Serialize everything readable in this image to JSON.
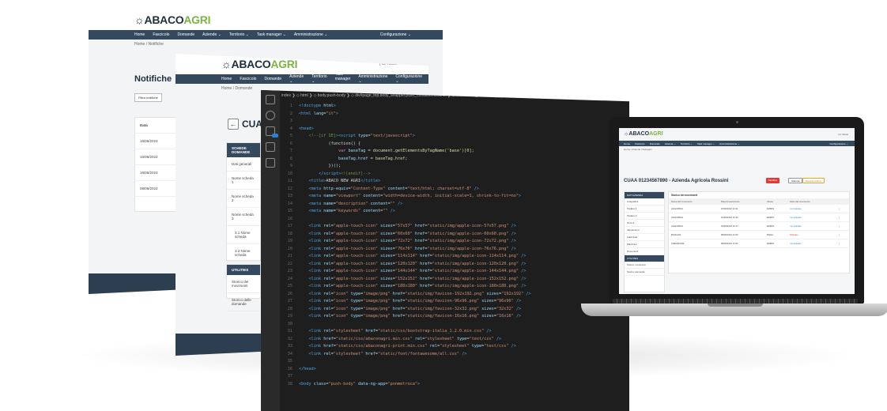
{
  "brand": {
    "part1": "ABACO",
    "part2": "AGRI"
  },
  "screen_back": {
    "user": "| G. Rossi",
    "nav": [
      "Home",
      "Fascicolo",
      "Domande",
      "Aziende ⌄",
      "Territorio ⌄",
      "Task manager ⌄",
      "Amministrazione ⌄"
    ],
    "config": "Configurazione ⌄",
    "crumbs": "Home / Notifiche",
    "title": "Notifiche",
    "filter": "Filtra notifiche",
    "list_head": "Data",
    "rows": [
      "16/06/2022",
      "16/06/2022",
      "16/06/2022",
      "08/06/2022"
    ]
  },
  "screen_mid": {
    "user": "| G. Rossi",
    "nav": [
      "Home",
      "Fascicolo",
      "Domande",
      "Aziende ⌄",
      "Territorio ⌄",
      "Task manager ⌄",
      "Amministrazione ⌄"
    ],
    "config": "Configurazione ⌄",
    "crumbs": "Home / Domande",
    "cuaa": "CUAA",
    "side_head": "SCHEDE DOMANDE",
    "side_rows": [
      "Dati generali",
      "Nome scheda 1",
      "Nome scheda 2",
      "Nome scheda 3",
      "3.1 Nome scheda",
      "3.2 Nome scheda",
      "3.3 Nome scheda",
      "Nome scheda 4"
    ],
    "util_head": "UTILITIES",
    "util_rows": [
      "Storico dei movimenti",
      "Storico delle domande"
    ]
  },
  "editor": {
    "breadcrumb": "index ❯ ◇ html ❯ ◇ body.push-body ❯ ◇ div#page_top.body_wrapper.push_container.clearfix ❯ ◇ main#main_container ❯ ◇ section#section_evidenza ❯ ◇ div.container ❯",
    "lines": [
      {
        "n": "1",
        "html": "<span class='tag'>&lt;!doctype</span> <span class='attr'>html</span><span class='tag'>&gt;</span>"
      },
      {
        "n": "2",
        "html": "<span class='tag'>&lt;html</span> <span class='attr'>lang</span>=<span class='str'>\"it\"</span><span class='tag'>&gt;</span>"
      },
      {
        "n": "3",
        "html": ""
      },
      {
        "n": "4",
        "html": "<span class='tag'>&lt;head&gt;</span>"
      },
      {
        "n": "5",
        "html": "    <span class='cm'>&lt;!--[if IE]&gt;</span><span class='tag'>&lt;script</span> <span class='attr'>type</span>=<span class='str'>\"text/javascript\"</span><span class='tag'>&gt;</span>"
      },
      {
        "n": "6",
        "html": "            <span class='tx'>(function() {</span>"
      },
      {
        "n": "7",
        "html": "                <span class='kw'>var</span> <span class='attr'>baseTag</span> = <span class='yl'>document.getElementsByTagName('base')[0];</span>"
      },
      {
        "n": "8",
        "html": "                <span class='attr'>baseTag.href</span> = <span class='yl'>baseTag.href;</span>"
      },
      {
        "n": "9",
        "html": "            <span class='tx'>})();</span>"
      },
      {
        "n": "10",
        "html": "        <span class='tag'>&lt;/script&gt;</span><span class='cm'>&lt;![endif]--&gt;</span>"
      },
      {
        "n": "11",
        "html": "    <span class='tag'>&lt;title&gt;</span><span class='tx'>ABACO NEW AGRI</span><span class='tag'>&lt;/title&gt;</span>"
      },
      {
        "n": "12",
        "html": "    <span class='tag'>&lt;meta</span> <span class='attr'>http-equiv</span>=<span class='str'>\"Content-Type\"</span> <span class='attr'>content</span>=<span class='str'>\"text/html; charset=utf-8\"</span> <span class='tag'>/&gt;</span>"
      },
      {
        "n": "13",
        "html": "    <span class='tag'>&lt;meta</span> <span class='attr'>name</span>=<span class='str'>\"viewport\"</span> <span class='attr'>content</span>=<span class='str'>\"width=device-width, initial-scale=1, shrink-to-fit=no\"</span><span class='tag'>&gt;</span>"
      },
      {
        "n": "14",
        "html": "    <span class='tag'>&lt;meta</span> <span class='attr'>name</span>=<span class='str'>\"description\"</span> <span class='attr'>content</span>=<span class='str'>\"\"</span> <span class='tag'>/&gt;</span>"
      },
      {
        "n": "15",
        "html": "    <span class='tag'>&lt;meta</span> <span class='attr'>name</span>=<span class='str'>\"keywords\"</span> <span class='attr'>content</span>=<span class='str'>\"\"</span> <span class='tag'>/&gt;</span>"
      },
      {
        "n": "16",
        "html": ""
      },
      {
        "n": "17",
        "html": "    <span class='tag'>&lt;link</span> <span class='attr'>rel</span>=<span class='str'>\"apple-touch-icon\"</span> <span class='attr'>sizes</span>=<span class='str'>\"57x57\"</span> <span class='attr'>href</span>=<span class='str'>\"static/img/apple-icon-57x57.png\"</span> <span class='tag'>/&gt;</span>"
      },
      {
        "n": "18",
        "html": "    <span class='tag'>&lt;link</span> <span class='attr'>rel</span>=<span class='str'>\"apple-touch-icon\"</span> <span class='attr'>sizes</span>=<span class='str'>\"60x60\"</span> <span class='attr'>href</span>=<span class='str'>\"static/img/apple-icon-60x60.png\"</span> <span class='tag'>/&gt;</span>"
      },
      {
        "n": "19",
        "html": "    <span class='tag'>&lt;link</span> <span class='attr'>rel</span>=<span class='str'>\"apple-touch-icon\"</span> <span class='attr'>sizes</span>=<span class='str'>\"72x72\"</span> <span class='attr'>href</span>=<span class='str'>\"static/img/apple-icon-72x72.png\"</span> <span class='tag'>/&gt;</span>"
      },
      {
        "n": "20",
        "html": "    <span class='tag'>&lt;link</span> <span class='attr'>rel</span>=<span class='str'>\"apple-touch-icon\"</span> <span class='attr'>sizes</span>=<span class='str'>\"76x76\"</span> <span class='attr'>href</span>=<span class='str'>\"static/img/apple-icon-76x76.png\"</span> <span class='tag'>/&gt;</span>"
      },
      {
        "n": "21",
        "html": "    <span class='tag'>&lt;link</span> <span class='attr'>rel</span>=<span class='str'>\"apple-touch-icon\"</span> <span class='attr'>sizes</span>=<span class='str'>\"114x114\"</span> <span class='attr'>href</span>=<span class='str'>\"static/img/apple-icon-114x114.png\"</span> <span class='tag'>/&gt;</span>"
      },
      {
        "n": "22",
        "html": "    <span class='tag'>&lt;link</span> <span class='attr'>rel</span>=<span class='str'>\"apple-touch-icon\"</span> <span class='attr'>sizes</span>=<span class='str'>\"120x120\"</span> <span class='attr'>href</span>=<span class='str'>\"static/img/apple-icon-120x120.png\"</span> <span class='tag'>/&gt;</span>"
      },
      {
        "n": "23",
        "html": "    <span class='tag'>&lt;link</span> <span class='attr'>rel</span>=<span class='str'>\"apple-touch-icon\"</span> <span class='attr'>sizes</span>=<span class='str'>\"144x144\"</span> <span class='attr'>href</span>=<span class='str'>\"static/img/apple-icon-144x144.png\"</span> <span class='tag'>/&gt;</span>"
      },
      {
        "n": "24",
        "html": "    <span class='tag'>&lt;link</span> <span class='attr'>rel</span>=<span class='str'>\"apple-touch-icon\"</span> <span class='attr'>sizes</span>=<span class='str'>\"152x152\"</span> <span class='attr'>href</span>=<span class='str'>\"static/img/apple-icon-152x152.png\"</span> <span class='tag'>/&gt;</span>"
      },
      {
        "n": "25",
        "html": "    <span class='tag'>&lt;link</span> <span class='attr'>rel</span>=<span class='str'>\"apple-touch-icon\"</span> <span class='attr'>sizes</span>=<span class='str'>\"180x180\"</span> <span class='attr'>href</span>=<span class='str'>\"static/img/apple-icon-180x180.png\"</span> <span class='tag'>/&gt;</span>"
      },
      {
        "n": "26",
        "html": "    <span class='tag'>&lt;link</span> <span class='attr'>rel</span>=<span class='str'>\"icon\"</span> <span class='attr'>type</span>=<span class='str'>\"image/png\"</span> <span class='attr'>href</span>=<span class='str'>\"static/img/favicon-192x192.png\"</span> <span class='attr'>sizes</span>=<span class='str'>\"192x192\"</span> <span class='tag'>/&gt;</span>"
      },
      {
        "n": "27",
        "html": "    <span class='tag'>&lt;link</span> <span class='attr'>rel</span>=<span class='str'>\"icon\"</span> <span class='attr'>type</span>=<span class='str'>\"image/png\"</span> <span class='attr'>href</span>=<span class='str'>\"static/img/favicon-96x96.png\"</span> <span class='attr'>sizes</span>=<span class='str'>\"96x96\"</span> <span class='tag'>/&gt;</span>"
      },
      {
        "n": "28",
        "html": "    <span class='tag'>&lt;link</span> <span class='attr'>rel</span>=<span class='str'>\"icon\"</span> <span class='attr'>type</span>=<span class='str'>\"image/png\"</span> <span class='attr'>href</span>=<span class='str'>\"static/img/favicon-32x32.png\"</span> <span class='attr'>sizes</span>=<span class='str'>\"32x32\"</span> <span class='tag'>/&gt;</span>"
      },
      {
        "n": "29",
        "html": "    <span class='tag'>&lt;link</span> <span class='attr'>rel</span>=<span class='str'>\"icon\"</span> <span class='attr'>type</span>=<span class='str'>\"image/png\"</span> <span class='attr'>href</span>=<span class='str'>\"static/img/favicon-16x16.png\"</span> <span class='attr'>sizes</span>=<span class='str'>\"16x16\"</span> <span class='tag'>/&gt;</span>"
      },
      {
        "n": "30",
        "html": ""
      },
      {
        "n": "31",
        "html": "    <span class='tag'>&lt;link</span> <span class='attr'>rel</span>=<span class='str'>\"stylesheet\"</span> <span class='attr'>href</span>=<span class='str'>\"static/css/bootstrap-italia_1.2.0.min.css\"</span> <span class='tag'>/&gt;</span>"
      },
      {
        "n": "32",
        "html": "    <span class='tag'>&lt;link</span> <span class='attr'>href</span>=<span class='str'>\"static/css/abaconagri.min.css\"</span> <span class='attr'>rel</span>=<span class='str'>\"stylesheet\"</span> <span class='attr'>type</span>=<span class='str'>\"text/css\"</span> <span class='tag'>/&gt;</span>"
      },
      {
        "n": "33",
        "html": "    <span class='tag'>&lt;link</span> <span class='attr'>href</span>=<span class='str'>\"static/css/abaconagri-print.min.css\"</span> <span class='attr'>rel</span>=<span class='str'>\"stylesheet\"</span> <span class='attr'>type</span>=<span class='str'>\"text/css\"</span> <span class='tag'>/&gt;</span>"
      },
      {
        "n": "34",
        "html": "    <span class='tag'>&lt;link</span> <span class='attr'>rel</span>=<span class='str'>\"stylesheet\"</span> <span class='attr'>href</span>=<span class='str'>\"static/font/fontawesome/all.css\"</span> <span class='tag'>/&gt;</span>"
      },
      {
        "n": "35",
        "html": ""
      },
      {
        "n": "36",
        "html": "<span class='tag'>&lt;/head&gt;</span>"
      },
      {
        "n": "37",
        "html": ""
      },
      {
        "n": "38",
        "html": "<span class='tag'>&lt;body</span> <span class='attr'>class</span>=<span class='str'>\"push-body\"</span> <span class='attr'>data-ng-app</span>=<span class='str'>\"ponmetroca\"</span><span class='tag'>&gt;</span>"
      }
    ]
  },
  "laptop": {
    "user": "| G. Rossi",
    "nav": [
      "Home",
      "Fascicolo",
      "Domande",
      "Aziende ⌄",
      "Territorio ⌄",
      "Task manager ⌄",
      "Amministrazione ⌄"
    ],
    "config": "Configurazione ⌄",
    "crumbs": "Home / Aziende / Dettaglio",
    "title": "CUAA 01234567890 - Azienda Agricola Rossini",
    "btn_red": "Modifica",
    "btn_gray": "Stampa",
    "btn_orange": "Esegui verifica",
    "side_head": "DATI AZIENDA",
    "side_rows": [
      "Anagrafica",
      "Titolare 1",
      "Titolare 2",
      "Terreni",
      "Allevamenti",
      "Fabbricati",
      "Macchine",
      "Documenti"
    ],
    "side_head2": "UTILITIES",
    "side_rows2": [
      "Storico movimenti",
      "Storico domande"
    ],
    "table_caption": "Storico dei movimenti",
    "table_headers": [
      "Nome del movimento",
      "Data di esecuzione",
      "Utente",
      "Esito del movimento"
    ],
    "table_rows": [
      [
        "AGGIORNA",
        "16/06/2022 10:21",
        "AMMIN",
        "Completato"
      ],
      [
        "AGGIORNA",
        "16/06/2022 10:20",
        "AMMIN",
        "Completato"
      ],
      [
        "AGGIORNA",
        "16/06/2022 10:17",
        "AMMIN",
        "Completato"
      ],
      [
        "RIVALIDA",
        "08/06/2022 12:06",
        "RIVALI",
        "Rifiutato"
      ],
      [
        "CREAZIONE",
        "08/06/2022 12:00",
        "AMMIN",
        "Completato"
      ]
    ]
  }
}
